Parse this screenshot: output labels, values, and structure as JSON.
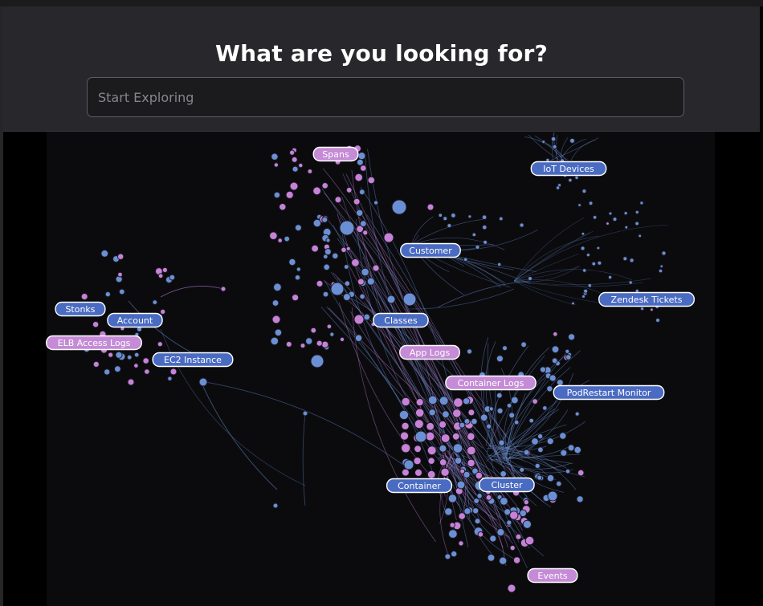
{
  "header": {
    "title": "What are you looking for?",
    "search_placeholder": "Start Exploring"
  },
  "colors": {
    "blue": "#6b8fd4",
    "purple": "#c782d8",
    "label_blue": "#4a6bc2",
    "label_purple": "#c58bd6"
  },
  "graph": {
    "labels": [
      {
        "id": "spans",
        "text": "Spans",
        "color": "purple"
      },
      {
        "id": "iot-devices",
        "text": "IoT Devices",
        "color": "blue"
      },
      {
        "id": "customer",
        "text": "Customer",
        "color": "blue"
      },
      {
        "id": "zendesk-tickets",
        "text": "Zendesk Tickets",
        "color": "blue"
      },
      {
        "id": "stonks",
        "text": "Stonks",
        "color": "blue"
      },
      {
        "id": "account",
        "text": "Account",
        "color": "blue"
      },
      {
        "id": "elb-access-logs",
        "text": "ELB Access Logs",
        "color": "purple"
      },
      {
        "id": "ec2-instance",
        "text": "EC2 Instance",
        "color": "blue"
      },
      {
        "id": "classes",
        "text": "Classes",
        "color": "blue"
      },
      {
        "id": "app-logs",
        "text": "App Logs",
        "color": "purple"
      },
      {
        "id": "container-logs",
        "text": "Container Logs",
        "color": "purple"
      },
      {
        "id": "podrestart-monitor",
        "text": "PodRestart Monitor",
        "color": "blue"
      },
      {
        "id": "container",
        "text": "Container",
        "color": "blue"
      },
      {
        "id": "cluster",
        "text": "Cluster",
        "color": "blue"
      },
      {
        "id": "events",
        "text": "Events",
        "color": "purple"
      }
    ]
  }
}
